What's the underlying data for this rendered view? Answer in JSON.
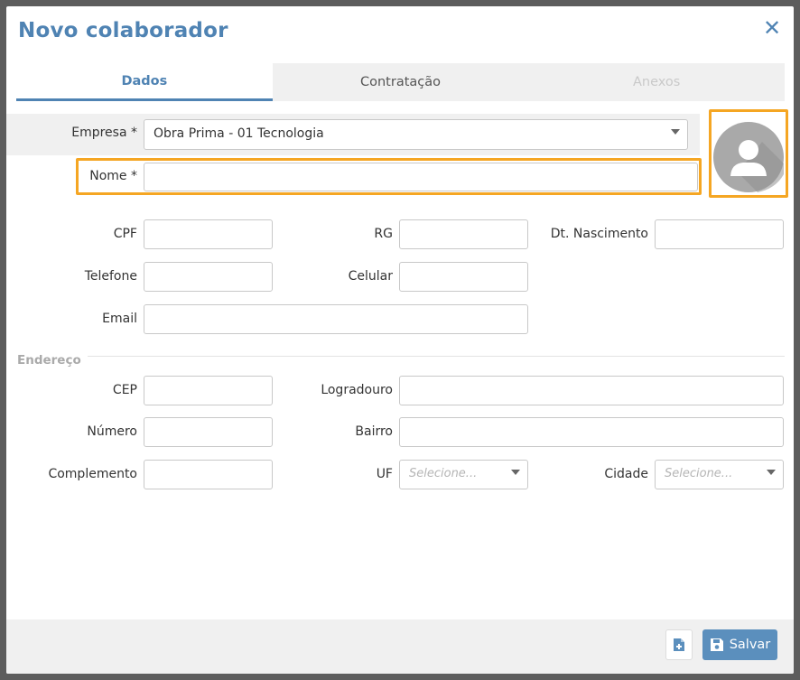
{
  "dialog": {
    "title": "Novo colaborador",
    "close_icon": "close-icon"
  },
  "tabs": [
    {
      "label": "Dados",
      "state": "active"
    },
    {
      "label": "Contratação",
      "state": "normal"
    },
    {
      "label": "Anexos",
      "state": "disabled"
    }
  ],
  "form": {
    "empresa": {
      "label": "Empresa *",
      "value": "Obra Prima - 01 Tecnologia"
    },
    "nome": {
      "label": "Nome *",
      "value": ""
    },
    "cpf": {
      "label": "CPF",
      "value": ""
    },
    "rg": {
      "label": "RG",
      "value": ""
    },
    "dt_nascimento": {
      "label": "Dt. Nascimento",
      "value": ""
    },
    "telefone": {
      "label": "Telefone",
      "value": ""
    },
    "celular": {
      "label": "Celular",
      "value": ""
    },
    "email": {
      "label": "Email",
      "value": ""
    }
  },
  "endereco": {
    "section_label": "Endereço",
    "cep": {
      "label": "CEP",
      "value": ""
    },
    "logradouro": {
      "label": "Logradouro",
      "value": ""
    },
    "numero": {
      "label": "Número",
      "value": ""
    },
    "bairro": {
      "label": "Bairro",
      "value": ""
    },
    "complemento": {
      "label": "Complemento",
      "value": ""
    },
    "uf": {
      "label": "UF",
      "placeholder": "Selecione..."
    },
    "cidade": {
      "label": "Cidade",
      "placeholder": "Selecione..."
    }
  },
  "footer": {
    "save_label": "Salvar",
    "save_icon": "floppy-disk-icon",
    "secondary_icon": "file-add-icon"
  },
  "colors": {
    "accent": "#4f83b3",
    "highlight": "#f5a623",
    "save_button": "#5b8fbd"
  }
}
